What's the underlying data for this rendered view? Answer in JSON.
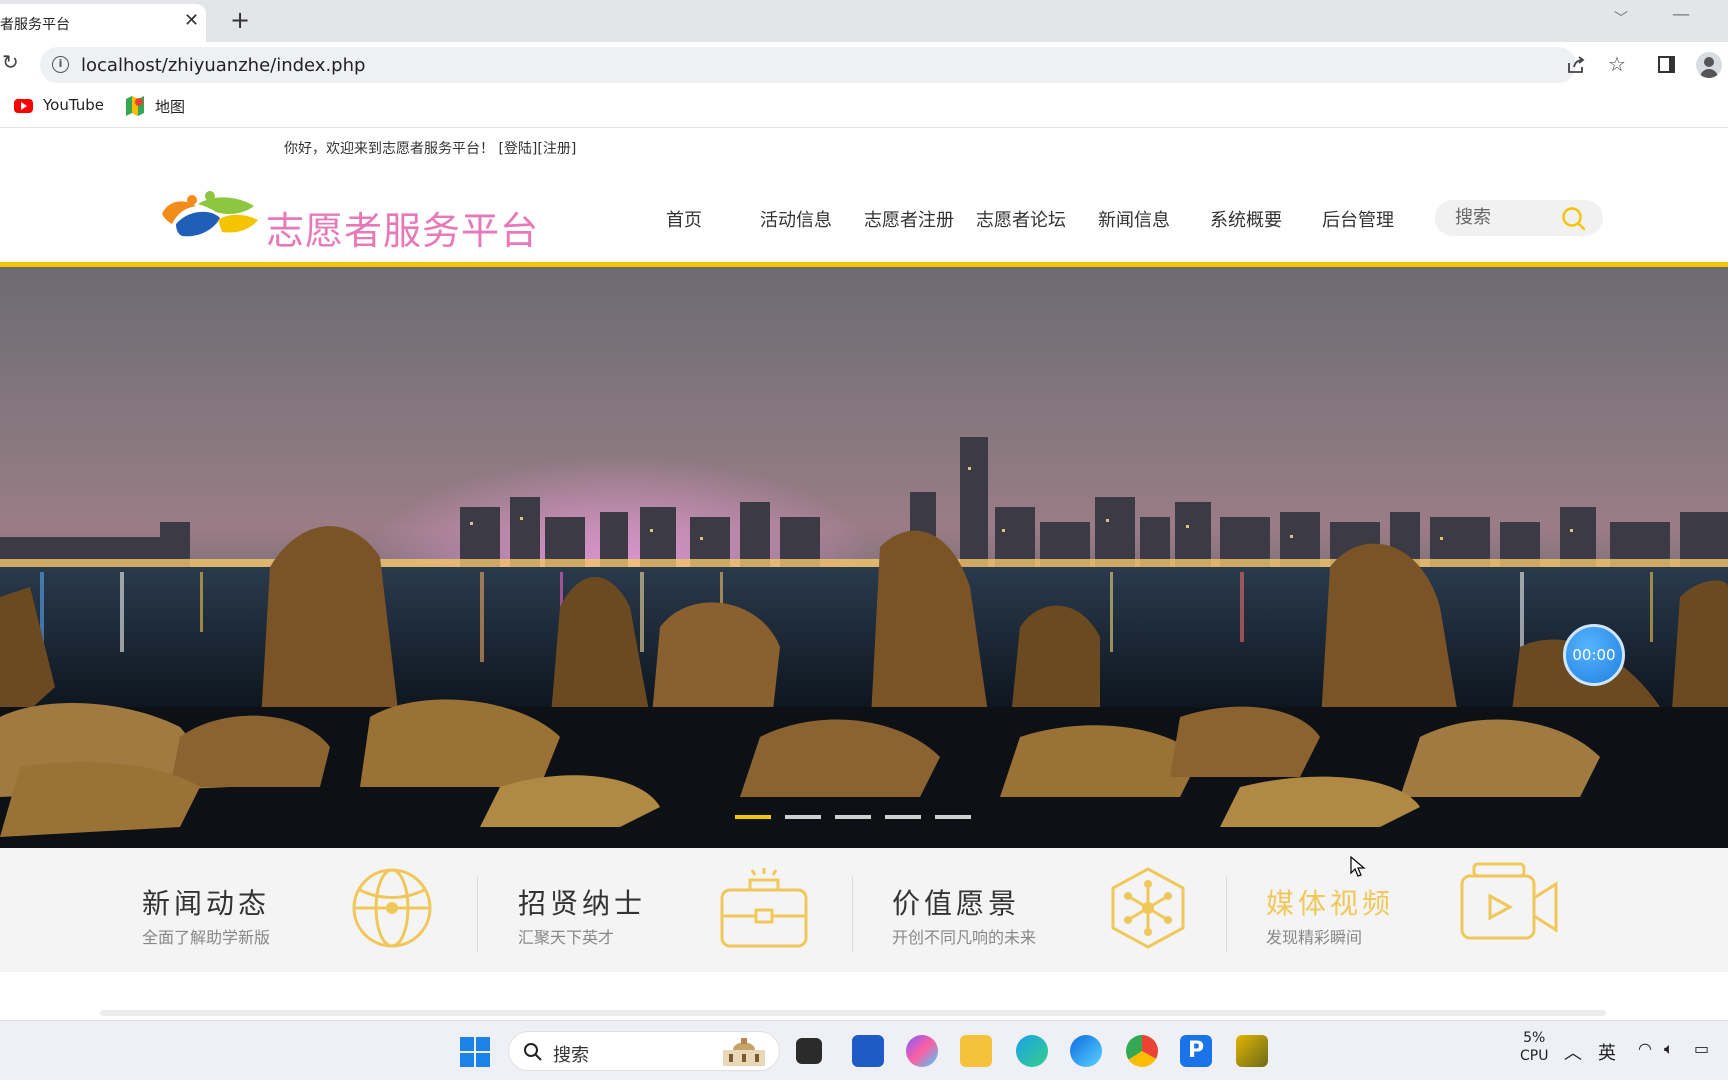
{
  "browser": {
    "tab_title": "者服务平台",
    "url": "localhost/zhiyuanzhe/index.php",
    "bookmarks": [
      "YouTube",
      "地图"
    ]
  },
  "page": {
    "welcome": "你好，欢迎来到志愿者服务平台！",
    "login": "[登陆]",
    "register": "[注册]",
    "logo_text": "志愿者服务平台",
    "nav": [
      "首页",
      "活动信息",
      "志愿者注册",
      "志愿者论坛",
      "新闻信息",
      "系统概要",
      "后台管理"
    ],
    "search_placeholder": "搜索",
    "timer": "00:00",
    "features": [
      {
        "title": "新闻动态",
        "subtitle": "全面了解助学新版"
      },
      {
        "title": "招贤纳士",
        "subtitle": "汇聚天下英才"
      },
      {
        "title": "价值愿景",
        "subtitle": "开创不同凡响的未来"
      },
      {
        "title": "媒体视频",
        "subtitle": "发现精彩瞬间"
      }
    ]
  },
  "taskbar": {
    "search_label": "搜索",
    "cpu_percent": "5%",
    "cpu_label": "CPU",
    "ime": "英"
  },
  "colors": {
    "accent_yellow": "#f5c400",
    "logo_pink": "#e879b8",
    "timer_blue": "#1f7fe0"
  }
}
